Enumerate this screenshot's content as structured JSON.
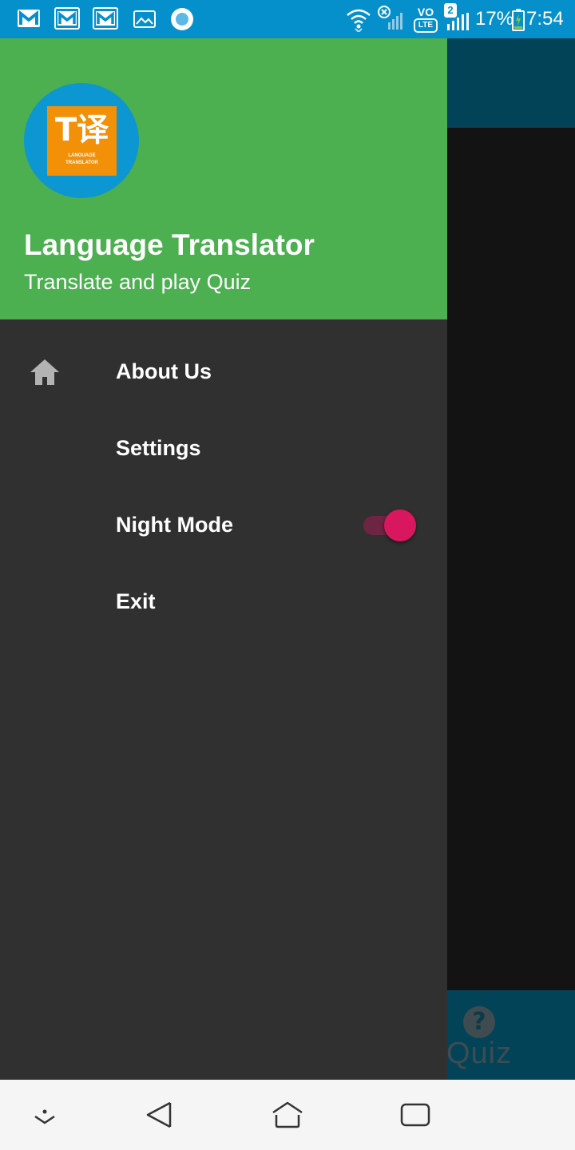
{
  "status_bar": {
    "notification_icons": [
      "gmail-icon",
      "gmail-icon",
      "gmail-icon",
      "gallery-icon",
      "circle-app-icon"
    ],
    "sim_badge": "2",
    "volte_top": "VO",
    "volte_bottom": "LTE",
    "battery": "17%",
    "time": "7:54"
  },
  "drawer": {
    "header": {
      "logo_text": "T译",
      "logo_caption_1": "LANGUAGE",
      "logo_caption_2": "TRANSLATOR",
      "title": "Language Translator",
      "subtitle": "Translate and play Quiz"
    },
    "items": [
      {
        "label": "About Us",
        "icon": "home-icon"
      },
      {
        "label": "Settings"
      },
      {
        "label": "Night Mode",
        "toggle": true,
        "toggle_on": true
      },
      {
        "label": "Exit"
      }
    ]
  },
  "background_app": {
    "bottom_tab": {
      "label": "Quiz",
      "icon": "help-icon",
      "icon_glyph": "?"
    }
  },
  "navigation_bar": [
    "collapse-icon",
    "back-icon",
    "home-icon",
    "recents-icon"
  ],
  "colors": {
    "status_bar": "#0590cc",
    "header": "#4caf50",
    "drawer_bg": "#313031",
    "accent": "#d8175f",
    "app_primary": "#024357"
  }
}
